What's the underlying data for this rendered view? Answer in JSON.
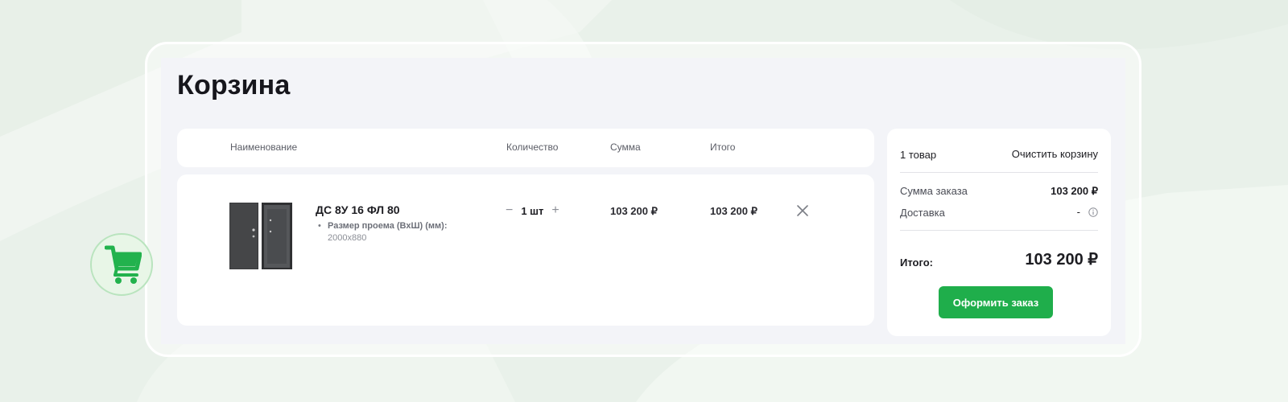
{
  "page": {
    "title": "Корзина"
  },
  "table": {
    "columns": {
      "name": "Наименование",
      "quantity": "Количество",
      "sum": "Сумма",
      "total": "Итого"
    }
  },
  "item": {
    "name": "ДС 8У 16 ФЛ 80",
    "spec_label": "Размер проема (ВхШ) (мм):",
    "spec_value": "2000х880",
    "quantity": "1 шт",
    "qty_minus": "−",
    "qty_plus": "+",
    "sum": "103 200 ₽",
    "total": "103 200 ₽"
  },
  "summary": {
    "count": "1 товар",
    "clear_label": "Очистить корзину",
    "order_sum_label": "Сумма заказа",
    "order_sum_value": "103 200 ₽",
    "delivery_label": "Доставка",
    "delivery_value": "-",
    "total_label": "Итого:",
    "total_value": "103 200 ₽",
    "checkout_label": "Оформить заказ"
  },
  "icons": {
    "cart": "cart-icon",
    "remove": "close-icon",
    "info": "info-icon"
  },
  "colors": {
    "accent": "#1fae4b",
    "background": "#e9f1ea",
    "panel": "#f3f4f8"
  }
}
